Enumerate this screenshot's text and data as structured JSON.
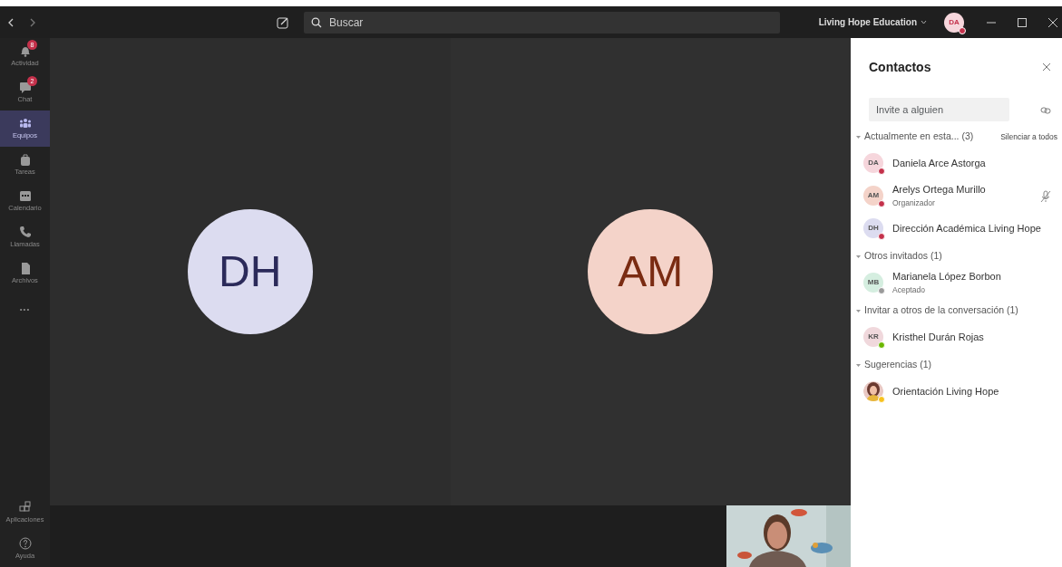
{
  "titlebar": {
    "search": {
      "placeholder": "Buscar"
    },
    "org": "Living Hope Education",
    "avatar": {
      "initials": "DA",
      "status": {
        "color": "#c4314b"
      }
    }
  },
  "rail": [
    {
      "label": "Actividad",
      "badge": "8",
      "selected": false
    },
    {
      "label": "Chat",
      "badge": "2",
      "selected": false
    },
    {
      "label": "Equipos",
      "selected": true
    },
    {
      "label": "Tareas",
      "selected": false
    },
    {
      "label": "Calendario",
      "selected": false
    },
    {
      "label": "Llamadas",
      "selected": false
    },
    {
      "label": "Archivos",
      "selected": false
    },
    {
      "kind": "more",
      "label": "•••",
      "selected": false
    }
  ],
  "rail_bottom": [
    {
      "label": "Aplicaciones"
    },
    {
      "label": "Ayuda"
    }
  ],
  "stage": {
    "tiles": [
      {
        "initials": "DH",
        "color": "#dcdcf0"
      },
      {
        "initials": "AM",
        "color": "#f4d3c9"
      }
    ]
  },
  "panel": {
    "title": "Contactos",
    "invite": {
      "placeholder": "Invite a alguien"
    },
    "sections": [
      {
        "title": "Actualmente en esta... (3)",
        "action": "Silenciar a todos",
        "expanded": true,
        "people": [
          {
            "initials": "DA",
            "color": "#f6d6dc",
            "name": "Daniela Arce Astorga",
            "status": {
              "color": "#c4314b"
            },
            "muted": false
          },
          {
            "initials": "AM",
            "color": "#f4d3c9",
            "name": "Arelys Ortega Murillo",
            "role": "Organizador",
            "status": {
              "color": "#c4314b"
            },
            "muted": true
          },
          {
            "initials": "DH",
            "color": "#dcdcf0",
            "name": "Dirección Académica Living Hope",
            "status": {
              "color": "#c4314b"
            },
            "muted": false
          }
        ]
      },
      {
        "title": "Otros invitados (1)",
        "expanded": true,
        "people": [
          {
            "initials": "MB",
            "color": "#d5eee0",
            "name": "Marianela López Borbon",
            "role": "Aceptado",
            "status": {
              "color": "#9a9a9a"
            },
            "muted": false
          }
        ]
      },
      {
        "title": "Invitar a otros de la conversación (1)",
        "expanded": true,
        "people": [
          {
            "initials": "KR",
            "color": "#f0d8dc",
            "name": "Kristhel Durán Rojas",
            "status": {
              "color": "#6bb700"
            },
            "muted": false
          }
        ]
      },
      {
        "title": "Sugerencias (1)",
        "expanded": true,
        "people": [
          {
            "kind": "picture",
            "name": "Orientación Living Hope",
            "status": {
              "color": "#f8c21d"
            },
            "muted": false
          }
        ]
      }
    ]
  }
}
